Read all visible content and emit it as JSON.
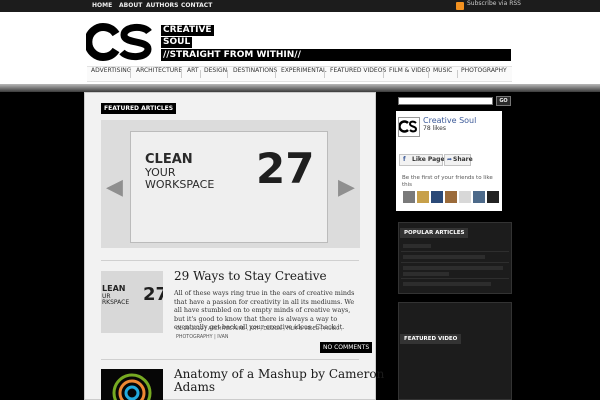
{
  "topnav": {
    "home": "Home",
    "about": "About",
    "authors": "Authors",
    "contact": "Contact",
    "subscribe": "Subscribe via RSS"
  },
  "header": {
    "logo_icon": "cs-logo-icon",
    "tag1": "CREATIVE",
    "tag2": "SOUL",
    "tagline": "//STRAIGHT FROM WITHIN//"
  },
  "nav": [
    "Advertising",
    "Architecture",
    "Art",
    "Design",
    "Destinations",
    "Experimental",
    "Featured Videos",
    "Film & Video",
    "Music",
    "Photography"
  ],
  "featured": {
    "label": "Featured Articles",
    "slide_line1": "CLEAN",
    "slide_line2": "YOUR",
    "slide_line3": "WORKSPACE",
    "slide_number": "27",
    "prev_icon": "left-arrow-icon",
    "next_icon": "right-arrow-icon"
  },
  "posts": [
    {
      "title": "29 Ways to Stay Creative",
      "thumb_line1": "LEAN",
      "thumb_line2": "UR",
      "thumb_line3": "RKSPACE",
      "thumb_number": "27",
      "excerpt": "All of these ways ring true in the ears of creative minds that have a passion for creativity in all its mediums. We all have stumbled on to empty minds of creative ways, but it's good to know that there is always a way to eventually get back all your creative ideas. Check it.",
      "meta_line1": [
        "01.20.2012",
        "Architecture",
        "Art",
        "Design",
        "Film & Video",
        "Music"
      ],
      "meta_line2": [
        "Photography",
        "Ivan"
      ],
      "comments": "No Comments"
    },
    {
      "title": "Anatomy of a Mashup by Cameron",
      "title2": "Adams"
    }
  ],
  "sidebar": {
    "search_button": "GO",
    "facebook": {
      "name": "Creative Soul",
      "likes": "78 likes",
      "like_button": "Like Page",
      "share_button": "Share",
      "message": "Be the first of your friends to like this"
    },
    "popular_title": "Popular Articles",
    "video_title": "Featured Video"
  },
  "colors": {
    "accent": "#000000",
    "background": "#000000",
    "panel": "#f2f2f2",
    "facebook": "#3b5998",
    "rss": "#f29120"
  }
}
